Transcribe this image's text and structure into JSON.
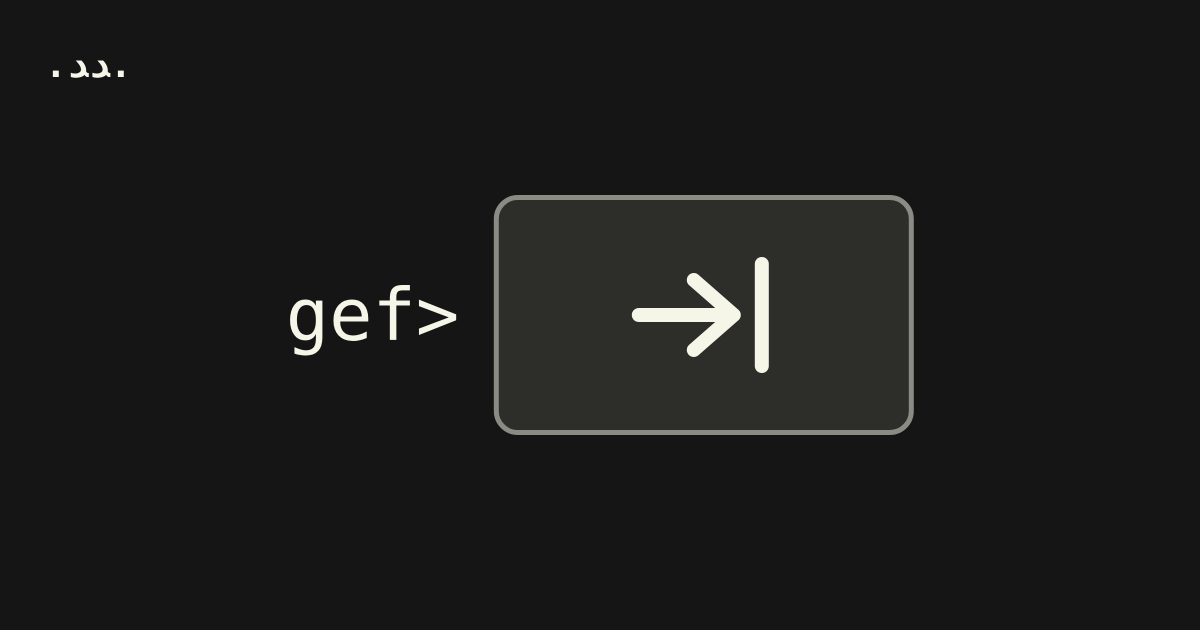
{
  "logo": {
    "text": ".ﺪﺪ."
  },
  "prompt": {
    "text": "gef>"
  },
  "colors": {
    "background": "#141514",
    "foreground": "#f5f5e8",
    "key_bg": "#2d2e29",
    "key_border": "#8a8b84"
  }
}
